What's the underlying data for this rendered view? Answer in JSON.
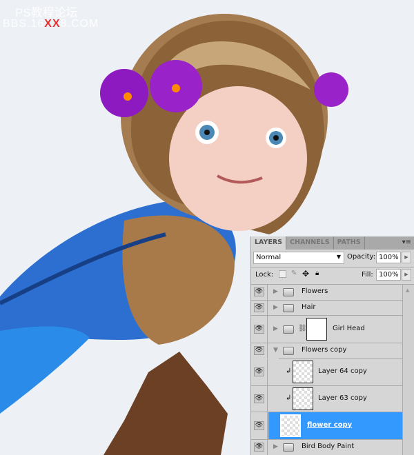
{
  "watermark": {
    "line1": "PS教程论坛",
    "line2_a": "BBS.16",
    "line2_x": "XX",
    "line2_b": "8.COM"
  },
  "panel": {
    "tabs": [
      {
        "label": "LAYERS",
        "active": true
      },
      {
        "label": "CHANNELS"
      },
      {
        "label": "PATHS"
      }
    ],
    "menu_icon": "panel-menu-icon",
    "blend_mode": "Normal",
    "opacity_label": "Opacity:",
    "opacity": "100%",
    "lock_label": "Lock:",
    "fill_label": "Fill:",
    "fill": "100%",
    "layers": [
      {
        "name": "Flowers",
        "type": "group",
        "expanded": false
      },
      {
        "name": "Hair",
        "type": "group",
        "expanded": false
      },
      {
        "name": "Girl Head",
        "type": "group",
        "expanded": false,
        "mask": true
      },
      {
        "name": "Flowers copy",
        "type": "group",
        "expanded": true
      },
      {
        "name": "Layer 64 copy",
        "type": "layer",
        "clipped": true
      },
      {
        "name": "Layer 63 copy",
        "type": "layer",
        "clipped": true
      },
      {
        "name": "flower copy",
        "type": "smart-object",
        "selected": true
      },
      {
        "name": "Bird Body Paint",
        "type": "group",
        "expanded": false
      }
    ]
  },
  "colors": {
    "selection": "#3399ff",
    "canvas": "#edf1f5"
  }
}
